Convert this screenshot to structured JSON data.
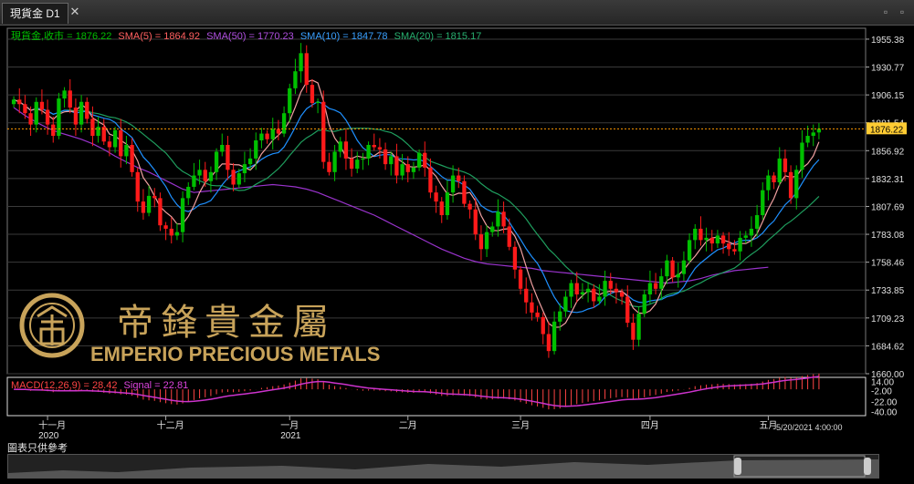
{
  "window": {
    "tab_title": "現貨金 D1",
    "close_label": "✕",
    "window_controls": [
      "▫",
      "▫"
    ]
  },
  "colors": {
    "up": "#00c000",
    "down": "#ff1a1a",
    "sma5": "#f0a0a0",
    "sma50": "#9933cc",
    "sma10": "#1e90ff",
    "sma20": "#1f9e5e",
    "macd_main": "#ff4444",
    "macd_signal": "#cc33cc",
    "current_line": "#ff9900",
    "gold": "#c8a35a"
  },
  "legend": [
    {
      "key": "close",
      "text": "現貨金,收市 = 1876.22",
      "color": "#00c000"
    },
    {
      "key": "sma5",
      "text": "SMA(5) = 1864.92",
      "color": "#ff6060"
    },
    {
      "key": "sma50",
      "text": "SMA(50) = 1770.23",
      "color": "#b050e0"
    },
    {
      "key": "sma10",
      "text": "SMA(10) = 1847.78",
      "color": "#3aa0ff"
    },
    {
      "key": "sma20",
      "text": "SMA(20) = 1815.17",
      "color": "#28b070"
    }
  ],
  "macd_legend": {
    "main": "MACD(12,26,9) = 28.42",
    "signal": "Signal = 22.81"
  },
  "logo": {
    "chinese": "帝鋒貴金屬",
    "english": "EMPERIO PRECIOUS METALS",
    "emblem": "gold-coin-emblem"
  },
  "current_price_label": "1876.22",
  "disclaimer": "圖表只供參考",
  "chart_data": [
    {
      "type": "candlestick",
      "title": "現貨金 D1",
      "y_ticks": [
        1955.38,
        1930.77,
        1906.15,
        1881.54,
        1856.92,
        1832.31,
        1807.69,
        1783.08,
        1758.46,
        1733.85,
        1709.23,
        1684.62,
        1660.0
      ],
      "ylim": [
        1660.0,
        1965.0
      ],
      "x_ticks": [
        {
          "label": "十一月",
          "sub": "2020",
          "bar": 6
        },
        {
          "label": "十二月",
          "sub": "",
          "bar": 27
        },
        {
          "label": "一月",
          "sub": "2021",
          "bar": 49
        },
        {
          "label": "二月",
          "sub": "",
          "bar": 70
        },
        {
          "label": "三月",
          "sub": "",
          "bar": 90
        },
        {
          "label": "四月",
          "sub": "",
          "bar": 113
        },
        {
          "label": "五月",
          "sub": "",
          "bar": 134
        }
      ],
      "last_time_label": "5/20/2021 4:00:00",
      "current_price": 1876.22,
      "closes": [
        1902,
        1898,
        1890,
        1880,
        1900,
        1893,
        1880,
        1870,
        1903,
        1910,
        1895,
        1880,
        1900,
        1885,
        1870,
        1878,
        1865,
        1860,
        1875,
        1852,
        1862,
        1838,
        1812,
        1802,
        1817,
        1815,
        1791,
        1788,
        1782,
        1785,
        1815,
        1825,
        1835,
        1840,
        1830,
        1838,
        1856,
        1862,
        1840,
        1827,
        1837,
        1845,
        1850,
        1866,
        1872,
        1867,
        1876,
        1872,
        1890,
        1912,
        1927,
        1943,
        1915,
        1899,
        1900,
        1847,
        1838,
        1856,
        1865,
        1850,
        1841,
        1849,
        1850,
        1862,
        1860,
        1858,
        1845,
        1852,
        1835,
        1845,
        1838,
        1842,
        1855,
        1842,
        1820,
        1812,
        1800,
        1820,
        1835,
        1830,
        1810,
        1805,
        1783,
        1770,
        1785,
        1790,
        1803,
        1790,
        1772,
        1752,
        1735,
        1723,
        1714,
        1710,
        1695,
        1680,
        1706,
        1715,
        1728,
        1740,
        1730,
        1732,
        1735,
        1724,
        1728,
        1742,
        1735,
        1732,
        1728,
        1705,
        1690,
        1713,
        1730,
        1740,
        1735,
        1746,
        1760,
        1745,
        1748,
        1760,
        1778,
        1788,
        1778,
        1780,
        1775,
        1782,
        1775,
        1770,
        1768,
        1780,
        1782,
        1788,
        1800,
        1822,
        1835,
        1829,
        1850,
        1838,
        1815,
        1840,
        1864,
        1870,
        1873,
        1876.22
      ],
      "sma50": [
        1895,
        1888,
        1882,
        1877,
        1873,
        1870,
        1867,
        1863,
        1858,
        1852,
        1847,
        1842,
        1838,
        1833,
        1828,
        1823,
        1820,
        1821,
        1822,
        1823,
        1824,
        1825,
        1826,
        1827,
        1826,
        1825,
        1823,
        1820,
        1816,
        1812,
        1808,
        1804,
        1800,
        1795,
        1790,
        1785,
        1780,
        1775,
        1770,
        1766,
        1762,
        1759,
        1757,
        1756,
        1755,
        1754,
        1753,
        1751,
        1750,
        1749,
        1748,
        1747,
        1746,
        1745,
        1744,
        1743,
        1742,
        1741,
        1740,
        1741,
        1742,
        1744,
        1747,
        1749,
        1751,
        1752,
        1753,
        1754
      ],
      "sma50_start": 0,
      "sma50_step": 2
    },
    {
      "type": "macd",
      "title": "MACD(12,26,9)",
      "y_ticks": [
        14.0,
        -2.0,
        -22.0,
        -40.0
      ],
      "ylim": [
        -46,
        20
      ],
      "main_value": 28.42,
      "signal_value": 22.81
    }
  ]
}
